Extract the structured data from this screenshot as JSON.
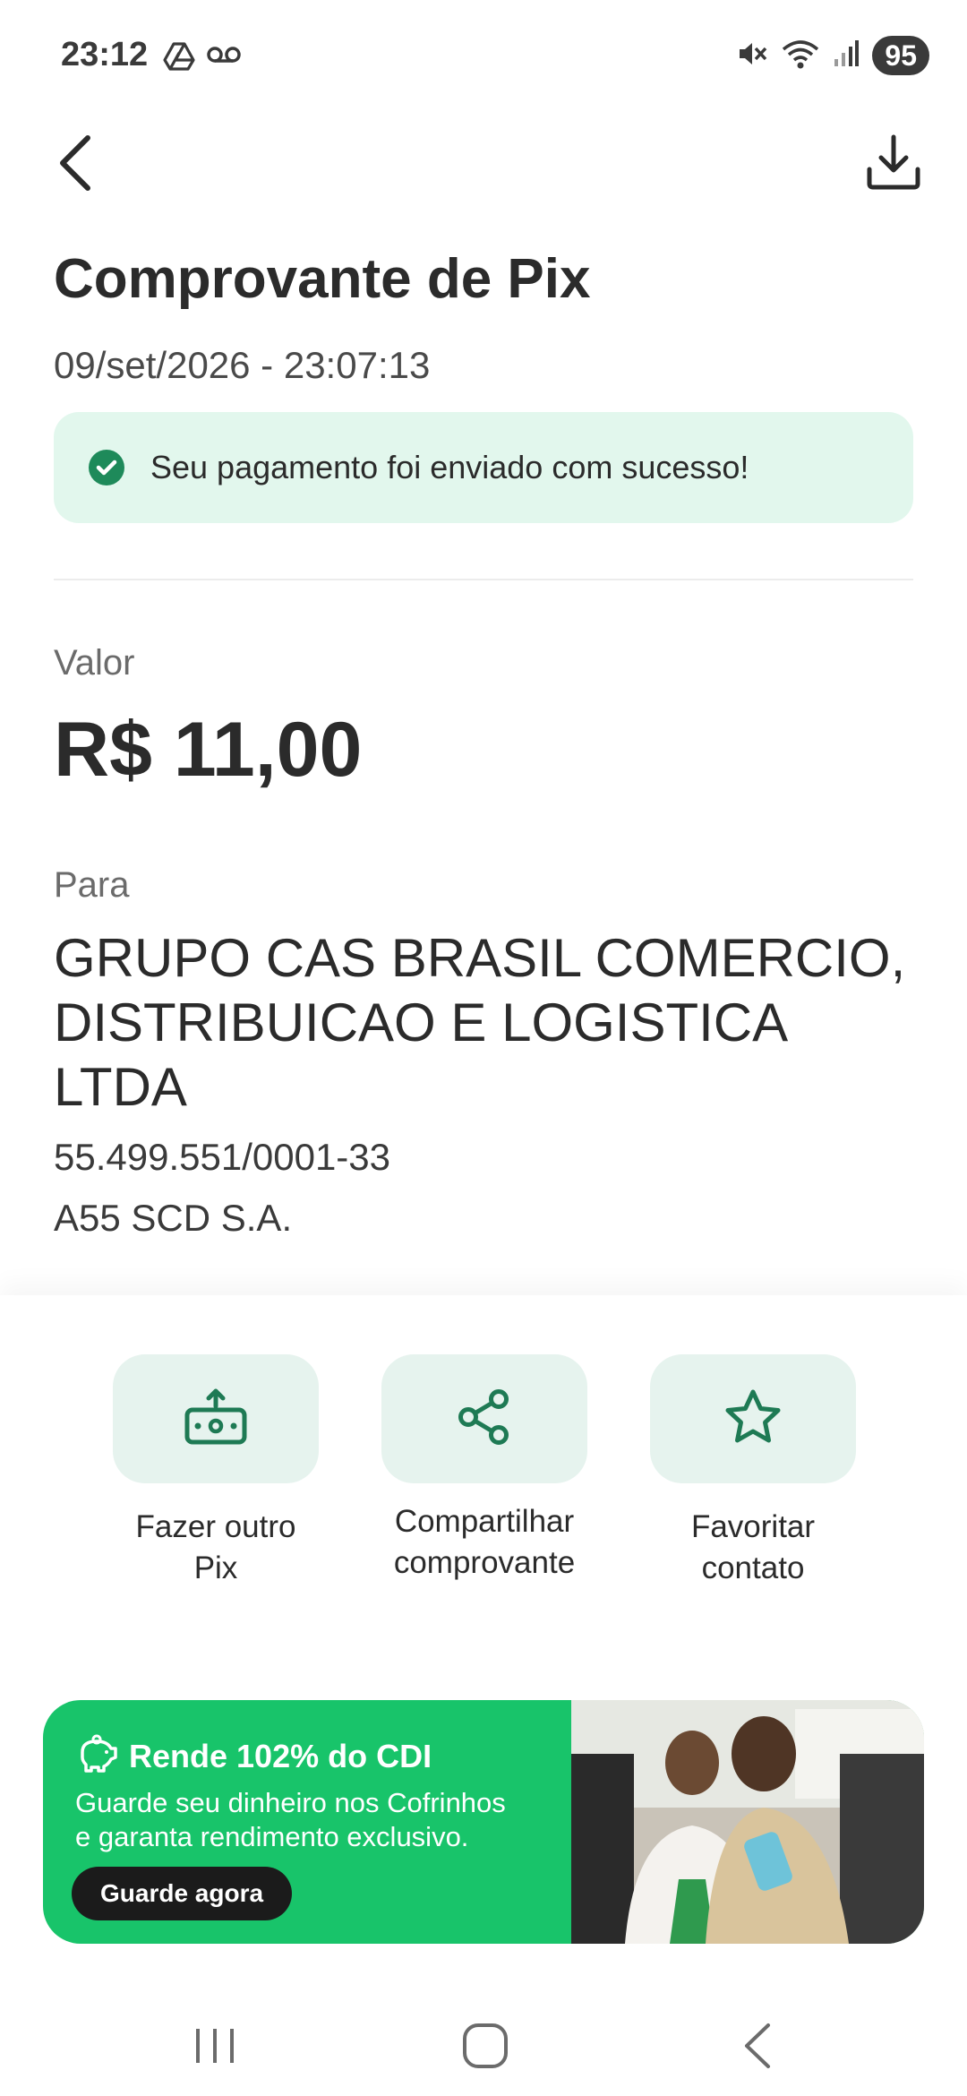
{
  "status_bar": {
    "time": "23:12",
    "battery": "95",
    "icons": [
      "drive-icon",
      "voicemail-icon",
      "mute-icon",
      "wifi-icon",
      "signal-icon"
    ]
  },
  "header": {
    "title": "Comprovante de Pix",
    "datetime": "09/set/2026 - 23:07:13",
    "back_icon": "chevron-left-icon",
    "download_icon": "download-icon"
  },
  "success": {
    "message": "Seu pagamento foi enviado com sucesso!",
    "color": "#1e8a5a",
    "background": "#e2f7ed"
  },
  "amount": {
    "label": "Valor",
    "value": "R$ 11,00"
  },
  "recipient": {
    "label": "Para",
    "name": "GRUPO CAS BRASIL COMERCIO, DISTRIBUICAO E LOGISTICA LTDA",
    "document": "55.499.551/0001-33",
    "institution": "A55 SCD S.A."
  },
  "actions": [
    {
      "label": "Fazer outro\nPix",
      "icon": "send-money-icon"
    },
    {
      "label": "Compartilhar\ncomprovante",
      "icon": "share-icon"
    },
    {
      "label": "Favoritar\ncontato",
      "icon": "star-icon"
    }
  ],
  "promo": {
    "title": "Rende 102% do CDI",
    "description": "Guarde seu dinheiro nos Cofrinhos\ne garanta rendimento exclusivo.",
    "button": "Guarde agora",
    "icon": "piggy-bank-icon",
    "color": "#18c46a"
  },
  "navbar": {
    "icons": [
      "recent-apps-icon",
      "home-icon",
      "back-icon"
    ]
  }
}
